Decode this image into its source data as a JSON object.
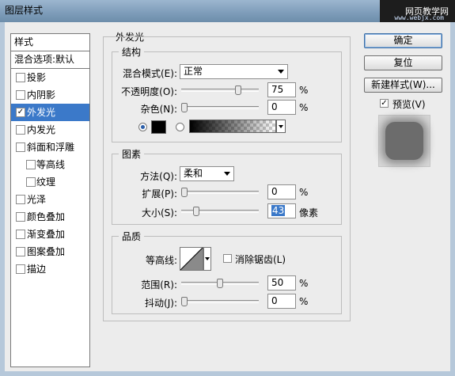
{
  "window": {
    "title": "图层样式",
    "watermark_line1": "网页教学网",
    "watermark_line2": "www.webjx.com"
  },
  "styles_panel": {
    "header": "样式",
    "blending": "混合选项:默认",
    "items": [
      {
        "label": "投影",
        "checked": false,
        "sub": false,
        "selected": false
      },
      {
        "label": "内阴影",
        "checked": false,
        "sub": false,
        "selected": false
      },
      {
        "label": "外发光",
        "checked": true,
        "sub": false,
        "selected": true
      },
      {
        "label": "内发光",
        "checked": false,
        "sub": false,
        "selected": false
      },
      {
        "label": "斜面和浮雕",
        "checked": false,
        "sub": false,
        "selected": false
      },
      {
        "label": "等高线",
        "checked": false,
        "sub": true,
        "selected": false
      },
      {
        "label": "纹理",
        "checked": false,
        "sub": true,
        "selected": false
      },
      {
        "label": "光泽",
        "checked": false,
        "sub": false,
        "selected": false
      },
      {
        "label": "颜色叠加",
        "checked": false,
        "sub": false,
        "selected": false
      },
      {
        "label": "渐变叠加",
        "checked": false,
        "sub": false,
        "selected": false
      },
      {
        "label": "图案叠加",
        "checked": false,
        "sub": false,
        "selected": false
      },
      {
        "label": "描边",
        "checked": false,
        "sub": false,
        "selected": false
      }
    ]
  },
  "outer_glow": {
    "title": "外发光",
    "structure": {
      "title": "结构",
      "blend_mode_label": "混合模式(E):",
      "blend_mode_value": "正常",
      "opacity_label": "不透明度(O):",
      "opacity_value": "75",
      "opacity_unit": "%",
      "opacity_level": 0.75,
      "noise_label": "杂色(N):",
      "noise_value": "0",
      "noise_unit": "%",
      "noise_level": 0,
      "glow_color": "#000000",
      "use_color": true
    },
    "elements": {
      "title": "图素",
      "method_label": "方法(Q):",
      "method_value": "柔和",
      "spread_label": "扩展(P):",
      "spread_value": "0",
      "spread_unit": "%",
      "spread_level": 0,
      "size_label": "大小(S):",
      "size_value": "43",
      "size_unit": "像素",
      "size_level": 0.17
    },
    "quality": {
      "title": "品质",
      "contour_label": "等高线:",
      "antialias_label": "消除锯齿(L)",
      "antialias_checked": false,
      "range_label": "范围(R):",
      "range_value": "50",
      "range_unit": "%",
      "range_level": 0.5,
      "jitter_label": "抖动(J):",
      "jitter_value": "0",
      "jitter_unit": "%",
      "jitter_level": 0
    }
  },
  "buttons": {
    "ok": "确定",
    "reset": "复位",
    "new_style": "新建样式(W)...",
    "preview": "预览(V)",
    "preview_checked": true
  }
}
